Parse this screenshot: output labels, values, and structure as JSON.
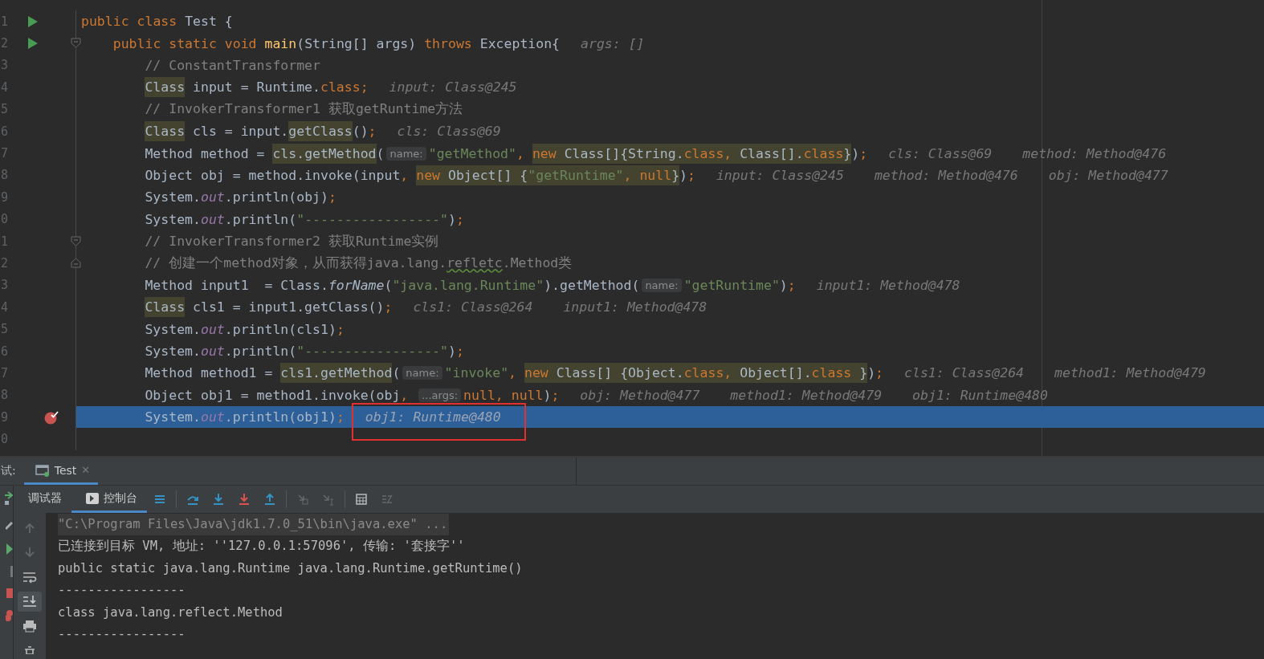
{
  "editor": {
    "lines": [
      {
        "number": "1",
        "selected": false,
        "marker": {
          "kind": "run"
        },
        "kind": "class",
        "segments": [
          {
            "kind": "code",
            "tokens": [
              {
                "text": "public class ",
                "kind": "keyword"
              },
              {
                "text": "Test {",
                "kind": "plain"
              }
            ]
          }
        ]
      },
      {
        "number": "2",
        "selected": false,
        "marker": {
          "kind": "run"
        },
        "fold": {
          "kind": "start"
        },
        "kind": "method",
        "segments": [
          {
            "kind": "code",
            "tokens": [
              {
                "text": "public static void ",
                "kind": "keyword"
              },
              {
                "text": "main",
                "kind": "method"
              },
              {
                "text": "(String[] args) ",
                "kind": "plain"
              },
              {
                "text": "throws ",
                "kind": "keyword"
              },
              {
                "text": "Exception{",
                "kind": "plain"
              }
            ]
          },
          {
            "kind": "value",
            "text": "args: []"
          }
        ]
      },
      {
        "number": "3",
        "selected": false,
        "kind": "body",
        "segments": [
          {
            "kind": "code",
            "tokens": [
              {
                "text": "// ConstantTransformer",
                "kind": "comment"
              }
            ]
          }
        ]
      },
      {
        "number": "4",
        "selected": false,
        "kind": "body",
        "segments": [
          {
            "kind": "highlight",
            "tokens": [
              {
                "text": "Class",
                "kind": "plain"
              }
            ]
          },
          {
            "kind": "code",
            "tokens": [
              {
                "text": " input = Runtime.",
                "kind": "plain"
              },
              {
                "text": "class;",
                "kind": "keyword"
              }
            ]
          },
          {
            "kind": "value",
            "text": "input: Class@245"
          }
        ]
      },
      {
        "number": "5",
        "selected": false,
        "kind": "body",
        "segments": [
          {
            "kind": "code",
            "tokens": [
              {
                "text": "// InvokerTransformer1 获取getRuntime方法",
                "kind": "comment"
              }
            ]
          }
        ]
      },
      {
        "number": "6",
        "selected": false,
        "kind": "body",
        "segments": [
          {
            "kind": "highlight",
            "tokens": [
              {
                "text": "Class",
                "kind": "plain"
              }
            ]
          },
          {
            "kind": "code",
            "tokens": [
              {
                "text": " cls = input.",
                "kind": "plain"
              }
            ]
          },
          {
            "kind": "highlight",
            "tokens": [
              {
                "text": "getClass",
                "kind": "plain"
              }
            ]
          },
          {
            "kind": "code",
            "tokens": [
              {
                "text": "()",
                "kind": "plain"
              },
              {
                "text": ";",
                "kind": "keyword"
              }
            ]
          },
          {
            "kind": "value",
            "text": "cls: Class@69"
          }
        ]
      },
      {
        "number": "7",
        "selected": false,
        "kind": "body",
        "segments": [
          {
            "kind": "code",
            "tokens": [
              {
                "text": "Method method = ",
                "kind": "plain"
              }
            ]
          },
          {
            "kind": "highlight",
            "tokens": [
              {
                "text": "cls.getMethod",
                "kind": "plain"
              }
            ]
          },
          {
            "kind": "code",
            "tokens": [
              {
                "text": "(",
                "kind": "plain"
              }
            ]
          },
          {
            "kind": "hint",
            "text": "name:"
          },
          {
            "kind": "code",
            "tokens": [
              {
                "text": "\"getMethod\"",
                "kind": "string"
              },
              {
                "text": ", ",
                "kind": "keyword"
              }
            ]
          },
          {
            "kind": "highlight",
            "tokens": [
              {
                "text": "new ",
                "kind": "keyword"
              },
              {
                "text": "Class[]{String.",
                "kind": "plain"
              },
              {
                "text": "class, ",
                "kind": "keyword"
              },
              {
                "text": "Class[].",
                "kind": "plain"
              },
              {
                "text": "class",
                "kind": "keyword"
              },
              {
                "text": "}",
                "kind": "plain"
              }
            ]
          },
          {
            "kind": "code",
            "tokens": [
              {
                "text": ")",
                "kind": "plain"
              },
              {
                "text": ";",
                "kind": "keyword"
              }
            ]
          },
          {
            "kind": "value",
            "text": "cls: Class@69"
          },
          {
            "kind": "value",
            "text": "method: Method@476"
          }
        ]
      },
      {
        "number": "8",
        "selected": false,
        "kind": "body",
        "segments": [
          {
            "kind": "code",
            "tokens": [
              {
                "text": "Object obj = method.invoke(input",
                "kind": "plain"
              },
              {
                "text": ", ",
                "kind": "keyword"
              }
            ]
          },
          {
            "kind": "highlight",
            "tokens": [
              {
                "text": "new ",
                "kind": "keyword"
              },
              {
                "text": "Object[] {",
                "kind": "plain"
              },
              {
                "text": "\"getRuntime\"",
                "kind": "string"
              },
              {
                "text": ", null",
                "kind": "keyword"
              },
              {
                "text": "}",
                "kind": "plain"
              }
            ]
          },
          {
            "kind": "code",
            "tokens": [
              {
                "text": ")",
                "kind": "plain"
              },
              {
                "text": ";",
                "kind": "keyword"
              }
            ]
          },
          {
            "kind": "value",
            "text": "input: Class@245"
          },
          {
            "kind": "value",
            "text": "method: Method@476"
          },
          {
            "kind": "value",
            "text": "obj: Method@477"
          }
        ]
      },
      {
        "number": "9",
        "selected": false,
        "kind": "body",
        "segments": [
          {
            "kind": "code",
            "tokens": [
              {
                "text": "System.",
                "kind": "plain"
              },
              {
                "text": "out",
                "kind": "field"
              },
              {
                "text": ".println(obj)",
                "kind": "plain"
              },
              {
                "text": ";",
                "kind": "keyword"
              }
            ]
          }
        ]
      },
      {
        "number": "0",
        "selected": false,
        "kind": "body",
        "segments": [
          {
            "kind": "code",
            "tokens": [
              {
                "text": "System.",
                "kind": "plain"
              },
              {
                "text": "out",
                "kind": "field"
              },
              {
                "text": ".println(",
                "kind": "plain"
              },
              {
                "text": "\"-----------------\"",
                "kind": "string"
              },
              {
                "text": ")",
                "kind": "plain"
              },
              {
                "text": ";",
                "kind": "keyword"
              }
            ]
          }
        ]
      },
      {
        "number": "1",
        "selected": false,
        "fold": {
          "kind": "start"
        },
        "kind": "body",
        "segments": [
          {
            "kind": "code",
            "tokens": [
              {
                "text": "// InvokerTransformer2 获取Runtime实例",
                "kind": "comment"
              }
            ]
          }
        ]
      },
      {
        "number": "2",
        "selected": false,
        "fold": {
          "kind": "end"
        },
        "kind": "body",
        "segments": [
          {
            "kind": "code",
            "tokens": [
              {
                "text": "// 创建一个method对象，从而获得java.lang.",
                "kind": "comment"
              },
              {
                "text": "refletc",
                "kind": "typo"
              },
              {
                "text": ".Method类",
                "kind": "comment"
              }
            ]
          }
        ]
      },
      {
        "number": "3",
        "selected": false,
        "kind": "body",
        "segments": [
          {
            "kind": "code",
            "tokens": [
              {
                "text": "Method input1  = Class.",
                "kind": "plain"
              },
              {
                "text": "forName",
                "kind": "italic"
              },
              {
                "text": "(",
                "kind": "plain"
              },
              {
                "text": "\"java.lang.Runtime\"",
                "kind": "string"
              },
              {
                "text": ").getMethod(",
                "kind": "plain"
              }
            ]
          },
          {
            "kind": "hint",
            "text": "name:"
          },
          {
            "kind": "code",
            "tokens": [
              {
                "text": "\"getRuntime\"",
                "kind": "string"
              },
              {
                "text": ")",
                "kind": "plain"
              },
              {
                "text": ";",
                "kind": "keyword"
              }
            ]
          },
          {
            "kind": "value",
            "text": "input1: Method@478"
          }
        ]
      },
      {
        "number": "4",
        "selected": false,
        "kind": "body",
        "segments": [
          {
            "kind": "highlight",
            "tokens": [
              {
                "text": "Class",
                "kind": "plain"
              }
            ]
          },
          {
            "kind": "code",
            "tokens": [
              {
                "text": " cls1 = input1.getClass()",
                "kind": "plain"
              },
              {
                "text": ";",
                "kind": "keyword"
              }
            ]
          },
          {
            "kind": "value",
            "text": "cls1: Class@264"
          },
          {
            "kind": "value",
            "text": "input1: Method@478"
          }
        ]
      },
      {
        "number": "5",
        "selected": false,
        "kind": "body",
        "segments": [
          {
            "kind": "code",
            "tokens": [
              {
                "text": "System.",
                "kind": "plain"
              },
              {
                "text": "out",
                "kind": "field"
              },
              {
                "text": ".println(cls1)",
                "kind": "plain"
              },
              {
                "text": ";",
                "kind": "keyword"
              }
            ]
          }
        ]
      },
      {
        "number": "6",
        "selected": false,
        "kind": "body",
        "segments": [
          {
            "kind": "code",
            "tokens": [
              {
                "text": "System.",
                "kind": "plain"
              },
              {
                "text": "out",
                "kind": "field"
              },
              {
                "text": ".println(",
                "kind": "plain"
              },
              {
                "text": "\"-----------------\"",
                "kind": "string"
              },
              {
                "text": ")",
                "kind": "plain"
              },
              {
                "text": ";",
                "kind": "keyword"
              }
            ]
          }
        ]
      },
      {
        "number": "7",
        "selected": false,
        "kind": "body",
        "segments": [
          {
            "kind": "code",
            "tokens": [
              {
                "text": "Method method1 = ",
                "kind": "plain"
              }
            ]
          },
          {
            "kind": "highlight",
            "tokens": [
              {
                "text": "cls1.getMethod",
                "kind": "plain"
              }
            ]
          },
          {
            "kind": "code",
            "tokens": [
              {
                "text": "(",
                "kind": "plain"
              }
            ]
          },
          {
            "kind": "hint",
            "text": "name:"
          },
          {
            "kind": "code",
            "tokens": [
              {
                "text": "\"invoke\"",
                "kind": "string"
              },
              {
                "text": ", ",
                "kind": "keyword"
              }
            ]
          },
          {
            "kind": "highlight",
            "tokens": [
              {
                "text": "new ",
                "kind": "keyword"
              },
              {
                "text": "Class[] {Object.",
                "kind": "plain"
              },
              {
                "text": "class, ",
                "kind": "keyword"
              },
              {
                "text": "Object[].",
                "kind": "plain"
              },
              {
                "text": "class ",
                "kind": "keyword"
              },
              {
                "text": "}",
                "kind": "plain"
              }
            ]
          },
          {
            "kind": "code",
            "tokens": [
              {
                "text": ")",
                "kind": "plain"
              },
              {
                "text": ";",
                "kind": "keyword"
              }
            ]
          },
          {
            "kind": "value",
            "text": "cls1: Class@264"
          },
          {
            "kind": "value",
            "text": "method1: Method@479"
          }
        ]
      },
      {
        "number": "8",
        "selected": false,
        "kind": "body",
        "segments": [
          {
            "kind": "code",
            "tokens": [
              {
                "text": "Object obj1 = method1.invoke(obj",
                "kind": "plain"
              },
              {
                "text": ", ",
                "kind": "keyword"
              }
            ]
          },
          {
            "kind": "hint",
            "text": "...args:"
          },
          {
            "kind": "code",
            "tokens": [
              {
                "text": "null, null",
                "kind": "keyword"
              },
              {
                "text": ")",
                "kind": "plain"
              },
              {
                "text": ";",
                "kind": "keyword"
              }
            ]
          },
          {
            "kind": "value",
            "text": "obj: Method@477"
          },
          {
            "kind": "value",
            "text": "method1: Method@479"
          },
          {
            "kind": "value",
            "text": "obj1: Runtime@480"
          }
        ]
      },
      {
        "number": "9",
        "selected": true,
        "marker": {
          "kind": "breakpoint"
        },
        "kind": "body",
        "segments": [
          {
            "kind": "code",
            "tokens": [
              {
                "text": "System.",
                "kind": "plain"
              },
              {
                "text": "out",
                "kind": "field"
              },
              {
                "text": ".println(obj1)",
                "kind": "plain"
              },
              {
                "text": ";",
                "kind": "keyword"
              }
            ]
          },
          {
            "kind": "value",
            "text": "obj1: Runtime@480",
            "boxed": true
          }
        ]
      },
      {
        "number": "0",
        "selected": false
      }
    ]
  },
  "debug_panel": {
    "label": "试:",
    "tabs": [
      {
        "label": "Test",
        "selected": true,
        "close": "✕"
      }
    ],
    "subtabs": [
      {
        "label": "调试器",
        "selected": false,
        "icon": false
      },
      {
        "label": "控制台",
        "selected": true,
        "icon": true
      }
    ],
    "toolbar": [
      {
        "kind": "layout",
        "disabled": false
      },
      {
        "kind": "step-over",
        "disabled": false
      },
      {
        "kind": "step-into",
        "disabled": false
      },
      {
        "kind": "force-step-into",
        "disabled": false
      },
      {
        "kind": "step-out",
        "disabled": false
      },
      {
        "kind": "drop-frame",
        "disabled": true
      },
      {
        "kind": "run-to-cursor",
        "disabled": true
      },
      {
        "kind": "evaluate",
        "disabled": false
      },
      {
        "kind": "trace",
        "disabled": true
      }
    ],
    "console": [
      {
        "kind": "command",
        "text": "\"C:\\Program Files\\Java\\jdk1.7.0_51\\bin\\java.exe\" ..."
      },
      {
        "kind": "output",
        "text": "已连接到目标 VM, 地址: ''127.0.0.1:57096', 传输: '套接字''"
      },
      {
        "kind": "output",
        "text": "public static java.lang.Runtime java.lang.Runtime.getRuntime()"
      },
      {
        "kind": "output",
        "text": "-----------------"
      },
      {
        "kind": "output",
        "text": "class java.lang.reflect.Method"
      },
      {
        "kind": "output",
        "text": "-----------------"
      }
    ]
  }
}
